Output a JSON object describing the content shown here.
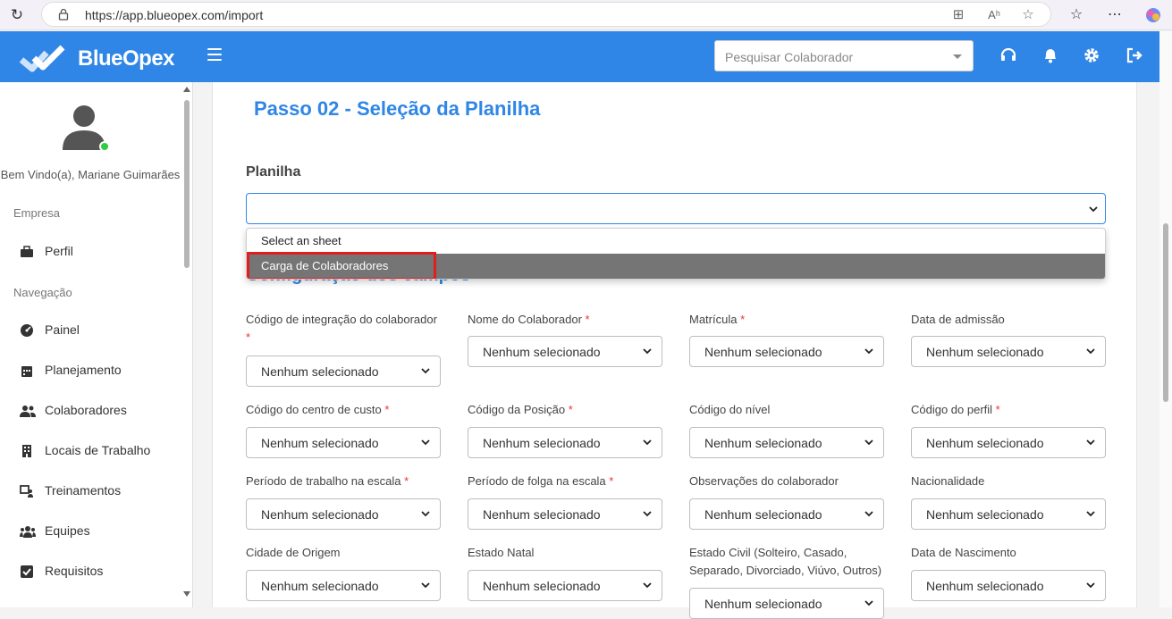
{
  "browser": {
    "url": "https://app.blueopex.com/import"
  },
  "header": {
    "brand": "BlueOpex",
    "search_placeholder": "Pesquisar Colaborador"
  },
  "sidebar": {
    "welcome": "Bem Vindo(a), Mariane Guimarães",
    "section_empresa": "Empresa",
    "section_navegacao": "Navegação",
    "items": [
      {
        "label": "Perfil",
        "icon": "briefcase-icon"
      },
      {
        "label": "Painel",
        "icon": "dashboard-icon"
      },
      {
        "label": "Planejamento",
        "icon": "calendar-icon"
      },
      {
        "label": "Colaboradores",
        "icon": "users-icon"
      },
      {
        "label": "Locais de Trabalho",
        "icon": "building-icon"
      },
      {
        "label": "Treinamentos",
        "icon": "training-icon"
      },
      {
        "label": "Equipes",
        "icon": "team-icon"
      },
      {
        "label": "Requisitos",
        "icon": "checkbox-icon"
      }
    ]
  },
  "main": {
    "title": "Passo 02 - Seleção da Planilha",
    "sheet_label": "Planilha",
    "sheet_value": "",
    "dropdown_options": [
      "Select an sheet",
      "Carga de Colaboradores"
    ],
    "subtitle_partial": "Configuração dos campos",
    "default_option": "Nenhum selecionado",
    "fields": [
      {
        "label": "Código de integração do colaborador",
        "required": true
      },
      {
        "label": "Nome do Colaborador",
        "required": true
      },
      {
        "label": "Matrícula",
        "required": true
      },
      {
        "label": "Data de admissão",
        "required": false
      },
      {
        "label": "Código do centro de custo",
        "required": true
      },
      {
        "label": "Código da Posição",
        "required": true
      },
      {
        "label": "Código do nível",
        "required": false
      },
      {
        "label": "Código do perfil",
        "required": true
      },
      {
        "label": "Período de trabalho na escala",
        "required": true
      },
      {
        "label": "Período de folga na escala",
        "required": true
      },
      {
        "label": "Observações do colaborador",
        "required": false
      },
      {
        "label": "Nacionalidade",
        "required": false
      },
      {
        "label": "Cidade de Origem",
        "required": false
      },
      {
        "label": "Estado Natal",
        "required": false
      },
      {
        "label": "Estado Civil (Solteiro, Casado, Separado, Divorciado, Viúvo, Outros)",
        "required": false
      },
      {
        "label": "Data de Nascimento",
        "required": false
      }
    ]
  },
  "colors": {
    "brand_blue": "#2f86e6",
    "required": "#ee3333",
    "option_highlight": "#757575",
    "annotation_red": "#e11d1d"
  }
}
